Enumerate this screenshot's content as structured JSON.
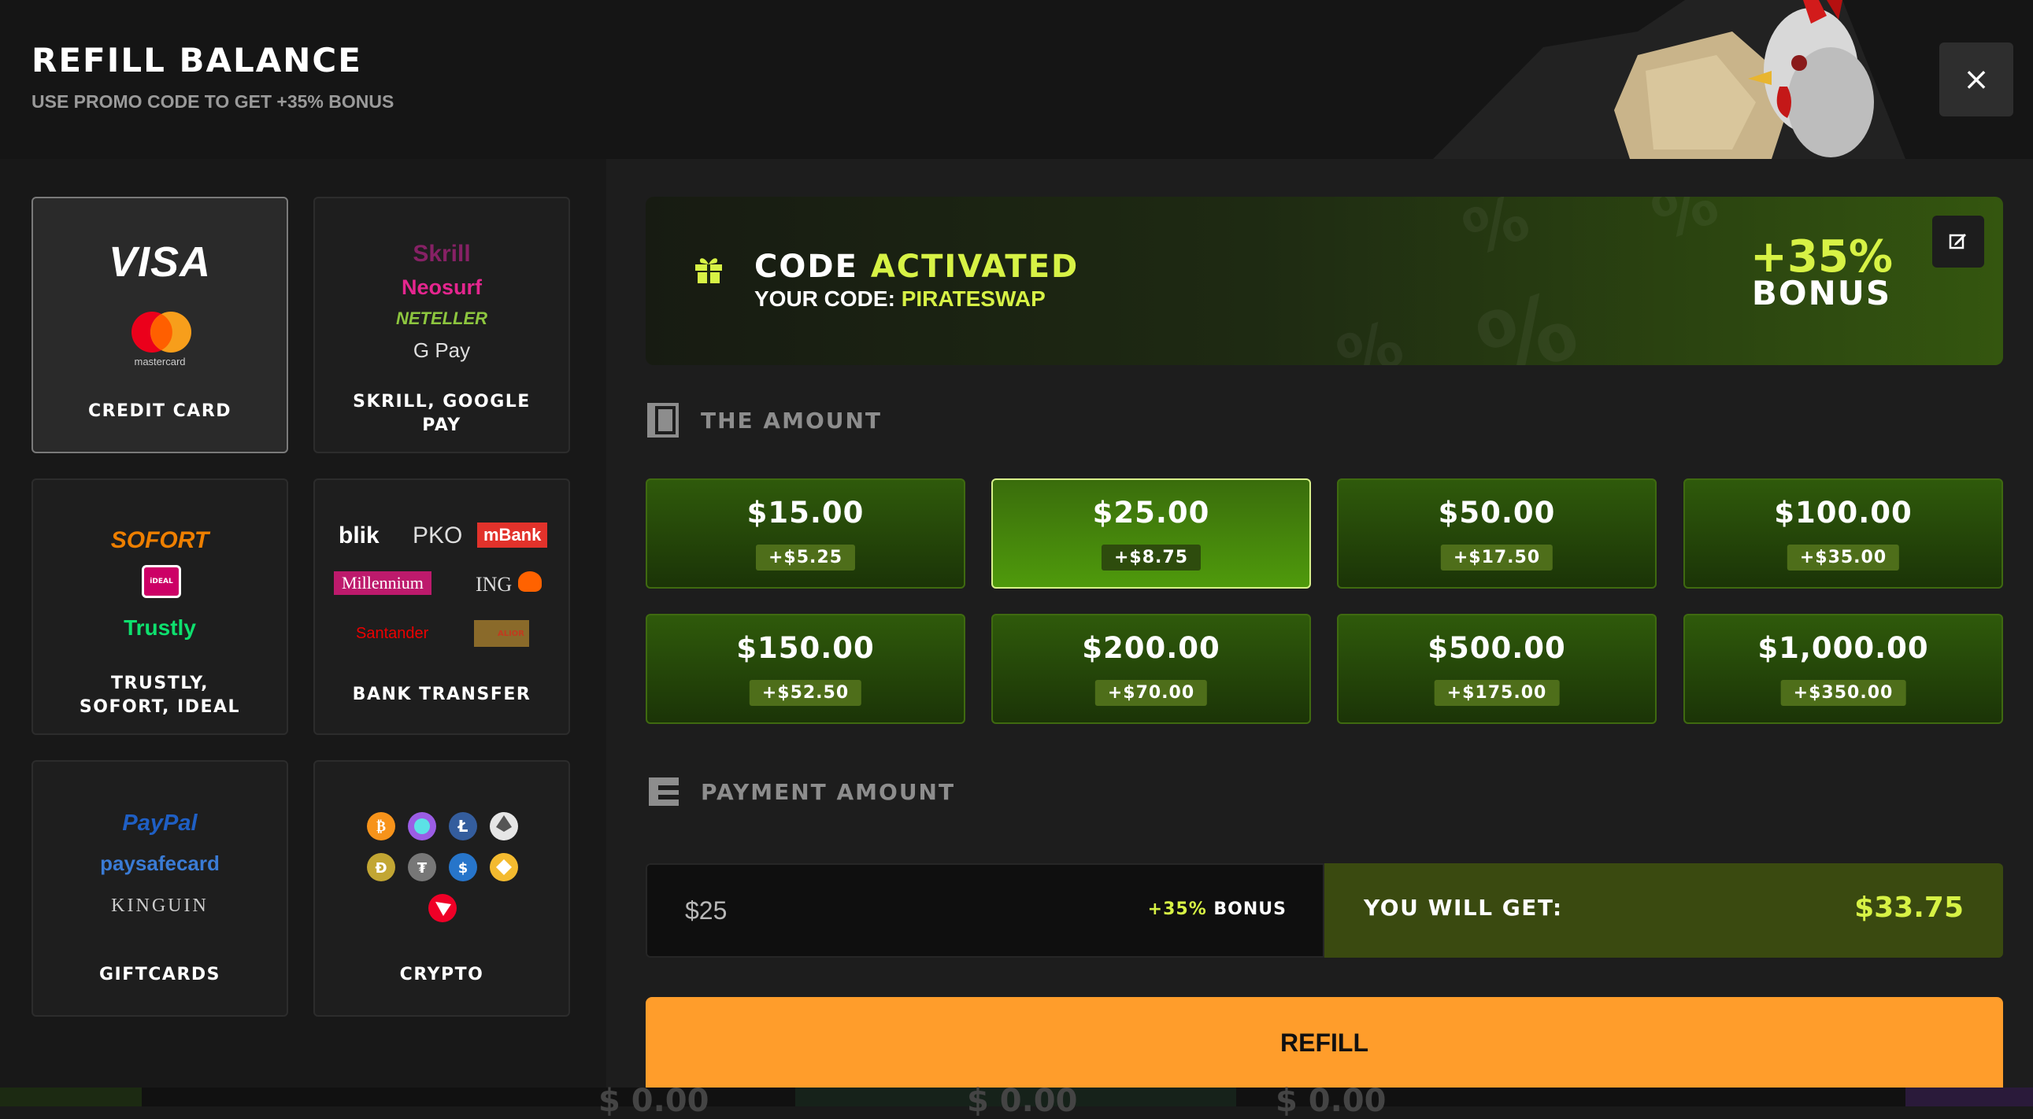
{
  "header": {
    "title": "REFILL BALANCE",
    "subtitle": "USE PROMO CODE TO GET +35% BONUS",
    "close_symbol": "×"
  },
  "methods": [
    {
      "label": "CREDIT CARD",
      "active": true,
      "logos": [
        "VISA",
        "mastercard"
      ]
    },
    {
      "label": "SKRILL, GOOGLE PAY",
      "active": false,
      "logos": [
        "Skrill",
        "Neosurf",
        "NETELLER",
        "G Pay"
      ]
    },
    {
      "label": "TRUSTLY, SOFORT, IDEAL",
      "active": false,
      "logos": [
        "SOFORT",
        "iDEAL",
        "Trustly"
      ]
    },
    {
      "label": "BANK TRANSFER",
      "active": false,
      "logos": [
        "blik",
        "PKO",
        "mBank",
        "Millennium",
        "ING",
        "Santander",
        "ALIOR"
      ]
    },
    {
      "label": "GIFTCARDS",
      "active": false,
      "logos": [
        "PayPal",
        "paysafecard",
        "KINGUIN"
      ]
    },
    {
      "label": "CRYPTO",
      "active": false,
      "logos": [
        "crypto coins"
      ]
    }
  ],
  "method_label_lines": {
    "skrill": [
      "SKRILL, GOOGLE",
      "PAY"
    ],
    "trustly": [
      "TRUSTLY,",
      "SOFORT, IDEAL"
    ]
  },
  "logos": {
    "visa": "VISA",
    "mastercard": "mastercard",
    "skrill": "Skrill",
    "neosurf": "Neosurf",
    "neteller": "NETELLER",
    "gpay": "G Pay",
    "sofort": "SOFORT",
    "ideal": "iDEAL",
    "trustly": "Trustly",
    "blik": "blik",
    "pko": "PKO",
    "mbank": "mBank",
    "millennium": "Millennium",
    "ing": "ING",
    "santander": "Santander",
    "alior": "ALIOR",
    "paypal": "PayPal",
    "paysafecard": "paysafecard",
    "kinguin": "KINGUIN"
  },
  "promo": {
    "code_word": "CODE",
    "activated_word": "ACTIVATED",
    "your_code_label": "YOUR CODE:",
    "code_value": "PIRATESWAP",
    "percent": "+35%",
    "bonus_word": "BONUS"
  },
  "amount_section": {
    "title": "THE AMOUNT"
  },
  "amounts": [
    {
      "value": "$15.00",
      "bonus": "+$5.25",
      "active": false
    },
    {
      "value": "$25.00",
      "bonus": "+$8.75",
      "active": true
    },
    {
      "value": "$50.00",
      "bonus": "+$17.50",
      "active": false
    },
    {
      "value": "$100.00",
      "bonus": "+$35.00",
      "active": false
    },
    {
      "value": "$150.00",
      "bonus": "+$52.50",
      "active": false
    },
    {
      "value": "$200.00",
      "bonus": "+$70.00",
      "active": false
    },
    {
      "value": "$500.00",
      "bonus": "+$175.00",
      "active": false
    },
    {
      "value": "$1,000.00",
      "bonus": "+$350.00",
      "active": false
    }
  ],
  "payment_section": {
    "title": "PAYMENT AMOUNT"
  },
  "payment": {
    "input_value": "$25",
    "bonus_pct": "+35%",
    "bonus_word": "BONUS",
    "you_will_get_label": "YOU WILL GET:",
    "you_will_get_value": "$33.75"
  },
  "refill_button": "REFILL",
  "background_ghost": [
    "$ 0.00",
    "$ 0.00",
    "$ 0.00"
  ],
  "colors": {
    "accent_green": "#d7f245",
    "refill_orange": "#ff9d2b"
  }
}
